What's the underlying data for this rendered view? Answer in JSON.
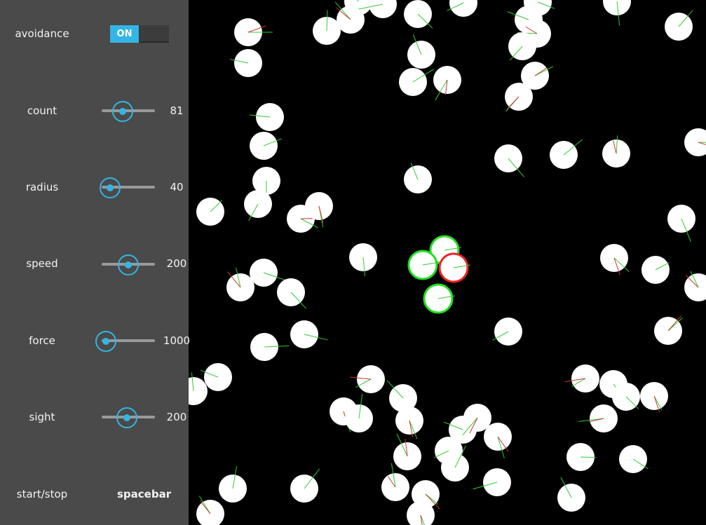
{
  "controls": {
    "avoidance": {
      "label": "avoidance",
      "state": "ON",
      "enabled": true
    },
    "sliders": [
      {
        "key": "count",
        "label": "count",
        "value": "81",
        "fill": 0.4
      },
      {
        "key": "radius",
        "label": "radius",
        "value": "40",
        "fill": 0.16
      },
      {
        "key": "speed",
        "label": "speed",
        "value": "200",
        "fill": 0.5
      },
      {
        "key": "force",
        "label": "force",
        "value": "1000",
        "fill": 0.08
      },
      {
        "key": "sight",
        "label": "sight",
        "value": "200",
        "fill": 0.48
      }
    ],
    "startstop": {
      "label": "start/stop",
      "key": "spacebar"
    }
  },
  "colors": {
    "panel": "#4a4a4a",
    "accent": "#33b5e5",
    "agent": "#ffffff",
    "neighbor_ring": "#22dd22",
    "focus_ring": "#ee2222",
    "background": "#000000"
  }
}
